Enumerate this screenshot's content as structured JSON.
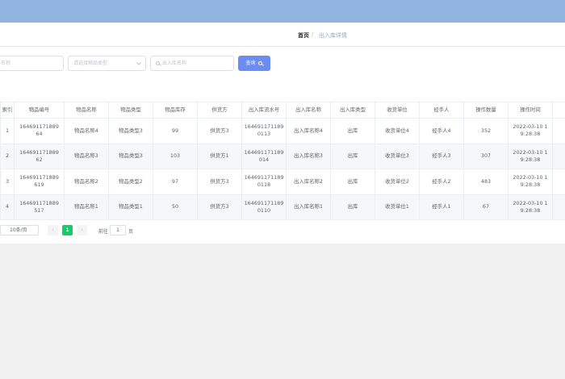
{
  "breadcrumb": {
    "home": "首页",
    "separator": "/",
    "current": "出入库详情"
  },
  "filters": {
    "name_placeholder": "名称",
    "type_placeholder": "请选择物品类型",
    "inout_placeholder": "出入库名称",
    "search_label": "查询"
  },
  "table": {
    "headers": [
      "索引",
      "物品编号",
      "物品名称",
      "物品类型",
      "物品库存",
      "供货方",
      "出入库流水号",
      "出入库名称",
      "出入库类型",
      "收货单位",
      "经手人",
      "操作数量",
      "操作时间"
    ],
    "rows": [
      [
        "1",
        "164691171889\n64",
        "物品名称4",
        "物品类型3",
        "99",
        "供货方3",
        "164691171189\n0113",
        "出入库名称4",
        "出库",
        "收货单位4",
        "经手人4",
        "352",
        "2022-03-10 1\n9:28:38"
      ],
      [
        "2",
        "164691171889\n62",
        "物品名称3",
        "物品类型3",
        "103",
        "供货方1",
        "164691171189\n014",
        "出入库名称3",
        "出库",
        "收货单位3",
        "经手人3",
        "307",
        "2022-03-10 1\n9:28:38"
      ],
      [
        "3",
        "164691171889\n619",
        "物品名称2",
        "物品类型2",
        "97",
        "供货方3",
        "164691171189\n0118",
        "出入库名称2",
        "出库",
        "收货单位2",
        "经手人2",
        "483",
        "2022-03-10 1\n9:28:38"
      ],
      [
        "4",
        "164691171889\n517",
        "物品名称1",
        "物品类型1",
        "50",
        "供货方3",
        "164691171189\n0110",
        "出入库名称1",
        "出库",
        "收货单位1",
        "经手人1",
        "67",
        "2022-03-10 1\n9:28:38"
      ]
    ]
  },
  "pagination": {
    "page_size": "10条/页",
    "prev": "‹",
    "current_page": "1",
    "next": "›",
    "goto_label": "前往",
    "goto_value": "1",
    "page_unit": "页"
  },
  "colors": {
    "topbar": "#91b3e0",
    "primary": "#6b8cf0",
    "active_page": "#13ce66"
  }
}
